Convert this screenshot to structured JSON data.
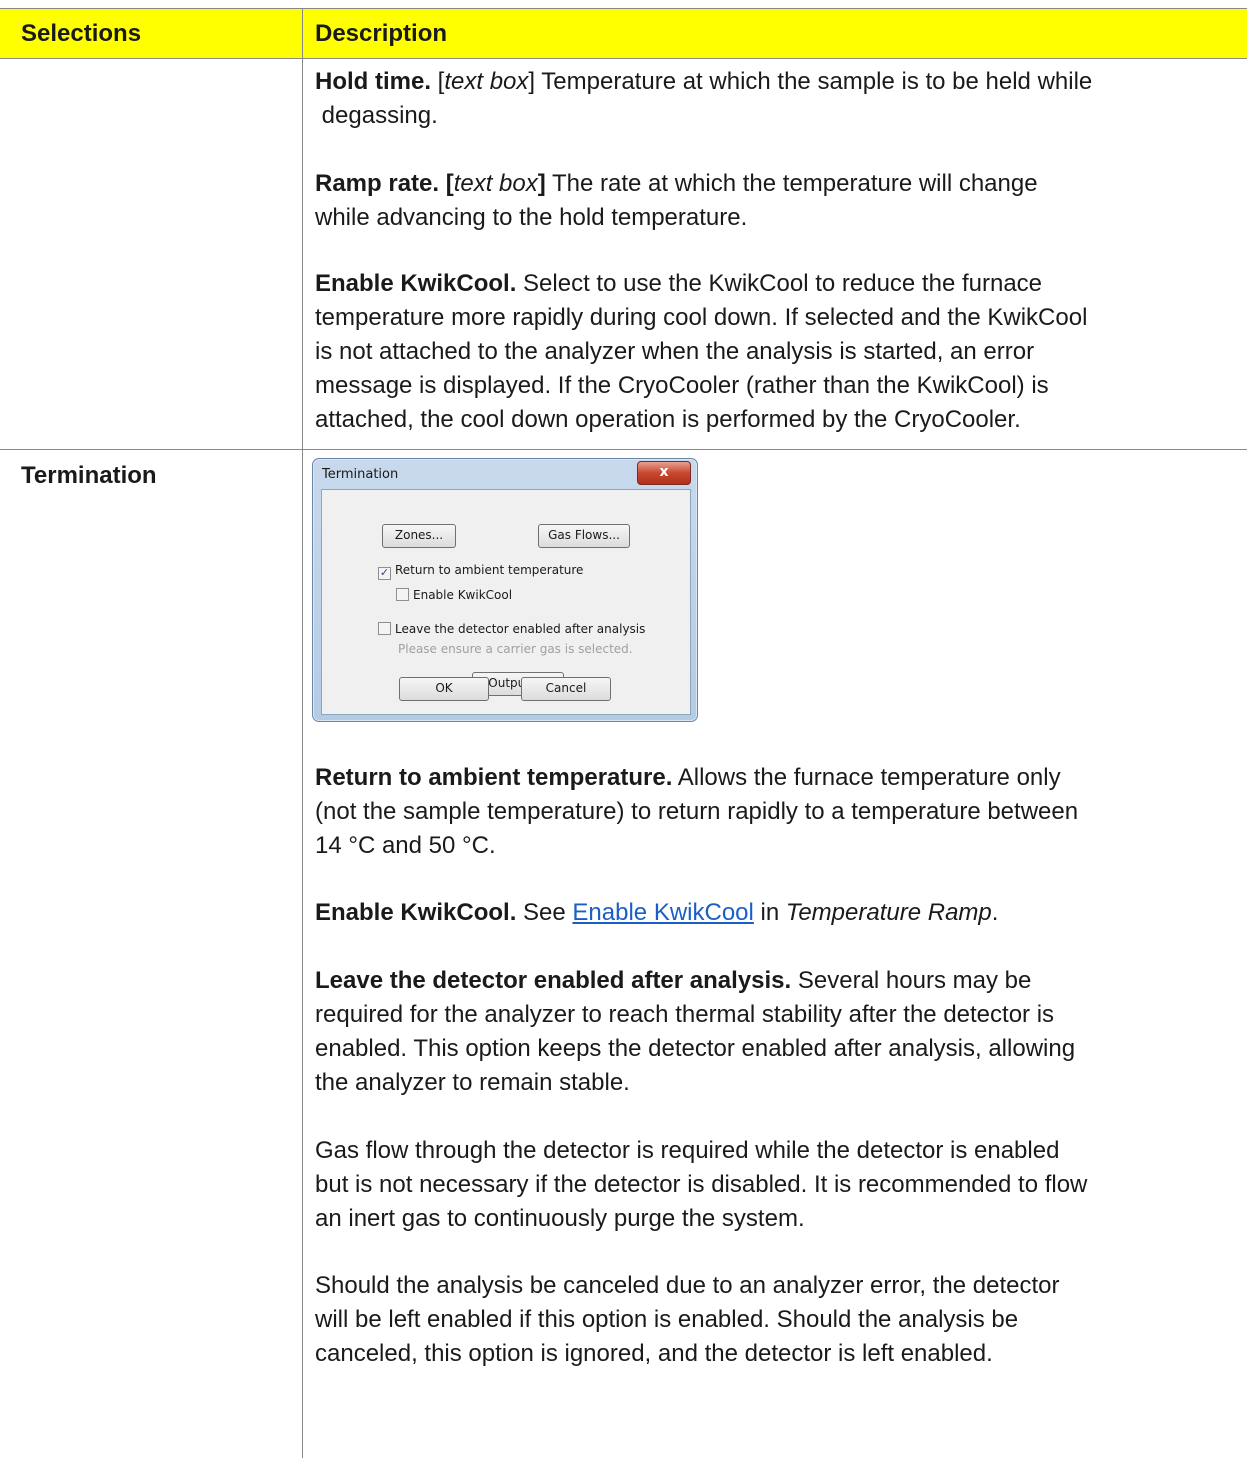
{
  "header": {
    "selections": "Selections",
    "description": "Description"
  },
  "row1": {
    "hold_time": {
      "label": "Hold time.",
      "bracket_open": " [",
      "italic": "text box",
      "rest": "] Temperature at which the sample is to be held while",
      "line2": "degassing."
    },
    "ramp_rate": {
      "label": "Ramp rate. [",
      "italic": "text box",
      "bracket_close": "]",
      "rest": " The rate at which the temperature will change",
      "line2": "while advancing to the hold temperature."
    },
    "kwikcool": {
      "label": "Enable KwikCool.",
      "rest": " Select to use the KwikCool to reduce the furnace",
      "lines": [
        "temperature more rapidly during cool down. If selected and the KwikCool",
        "is not attached to the analyzer when the analysis is started, an error",
        "message is displayed. If the CryoCooler (rather than the KwikCool) is",
        "attached, the cool down operation is performed by the CryoCooler."
      ]
    }
  },
  "row2": {
    "selection": "Termination",
    "dialog": {
      "title": "Termination",
      "close": "x",
      "zones_button": "Zones...",
      "gasflows_button": "Gas Flows...",
      "return_ambient": "Return to ambient temperature",
      "enable_kwikcool": "Enable KwikCool",
      "leave_detector": "Leave the detector enabled after analysis",
      "hint": "Please ensure a carrier gas is selected.",
      "outputs_button": "Outputs...",
      "ok_button": "OK",
      "cancel_button": "Cancel"
    },
    "return_ambient": {
      "label": "Return to ambient temperature.",
      "rest": " Allows the furnace temperature only",
      "line2": "(not the sample temperature) to return rapidly to a temperature between",
      "line3": "14 °C and 50 °C."
    },
    "enable_kwikcool": {
      "label": "Enable KwikCool.",
      "see": " See ",
      "link": "Enable KwikCool",
      "in": " in ",
      "italic": "Temperature Ramp",
      "period": "."
    },
    "leave_detector": {
      "label": "Leave the detector enabled after analysis.",
      "rest": " Several hours may be",
      "lines": [
        "required for the analyzer to reach thermal stability after the detector is",
        "enabled. This option keeps the detector enabled after analysis, allowing",
        "the analyzer to remain stable."
      ]
    },
    "gas_flow": [
      "Gas flow through the detector is required while the detector is enabled",
      "but is not necessary if the detector is disabled. It is recommended to flow",
      "an inert gas to continuously purge the system."
    ],
    "canceled": [
      "Should the analysis be canceled due to an analyzer error, the detector",
      "will be left enabled if this option is enabled. Should the analysis be",
      "canceled, this option is ignored, and the detector is left enabled."
    ]
  }
}
